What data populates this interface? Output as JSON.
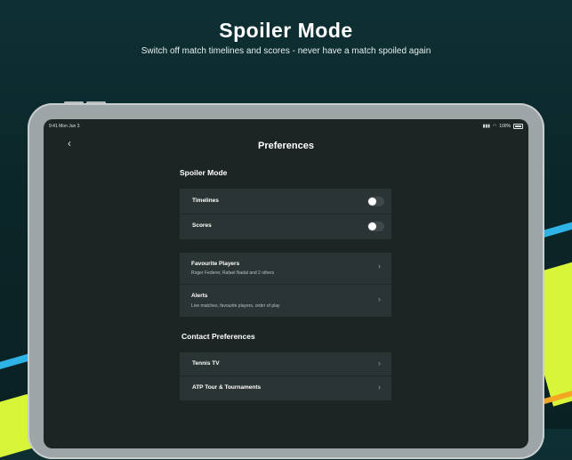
{
  "banner": {
    "headline": "Spoiler Mode",
    "subheadline": "Switch off match timelines and scores - never have a match spoiled again"
  },
  "status_bar": {
    "time": "9:41 Mon Jun 3",
    "battery": "100%"
  },
  "nav": {
    "back_icon": "chevron-left",
    "title": "Preferences"
  },
  "spoiler_section": {
    "title": "Spoiler Mode",
    "toggles": [
      {
        "label": "Timelines",
        "on": false
      },
      {
        "label": "Scores",
        "on": false
      }
    ]
  },
  "links": [
    {
      "label": "Favourite Players",
      "sub": "Roger Federer, Rafael Nadal and 2 others"
    },
    {
      "label": "Alerts",
      "sub": "Live matches, favourite players, order of play"
    }
  ],
  "contact_section": {
    "title": "Contact Preferences",
    "items": [
      {
        "label": "Tennis TV"
      },
      {
        "label": "ATP Tour & Tournaments"
      }
    ]
  },
  "colors": {
    "accent_lime": "#d9f53a",
    "accent_blue": "#2fb3e6",
    "accent_orange": "#f4a623"
  }
}
